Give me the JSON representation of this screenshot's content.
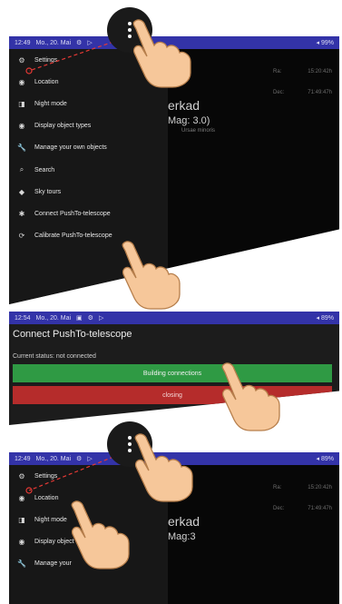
{
  "panel1": {
    "status_bar": {
      "time": "12:49",
      "date": "Mo., 20. Mai",
      "battery": "99%"
    },
    "menu_items": [
      {
        "label": "Settings",
        "icon": "gear-icon",
        "glyph": "⚙"
      },
      {
        "label": "Location",
        "icon": "location-icon",
        "glyph": "◉"
      },
      {
        "label": "Night mode",
        "icon": "night-mode-icon",
        "glyph": "◨"
      },
      {
        "label": "Display object types",
        "icon": "eye-icon",
        "glyph": "◉"
      },
      {
        "label": "Manage your own objects",
        "icon": "wrench-icon",
        "glyph": "🔧"
      },
      {
        "label": "Search",
        "icon": "search-icon",
        "glyph": "⌕"
      },
      {
        "label": "Sky tours",
        "icon": "tour-icon",
        "glyph": "◆"
      },
      {
        "label": "Connect PushTo-telescope",
        "icon": "bluetooth-icon",
        "glyph": "✱"
      },
      {
        "label": "Calibrate PushTo-telescope",
        "icon": "calibrate-icon",
        "glyph": "⟳"
      }
    ],
    "sky": {
      "ra_label": "Ra:",
      "ra_value": "15:20:42h",
      "dec_label": "Dec:",
      "dec_value": "71:49:47h",
      "object_name": "erkad",
      "object_mag": "Mag: 3.0)",
      "object_sub": "Ursae minoris"
    }
  },
  "panel2": {
    "status_bar": {
      "time": "12:54",
      "date": "Mo., 20. Mai",
      "battery": "89%"
    },
    "title": "Connect PushTo-telescope",
    "status_text": "Current status: not connected",
    "connect_button": "Building connections",
    "close_button": "closing"
  },
  "panel3": {
    "status_bar": {
      "time": "12:49",
      "date": "Mo., 20. Mai",
      "battery": "89%"
    },
    "menu_items": [
      {
        "label": "Settings",
        "icon": "gear-icon",
        "glyph": "⚙"
      },
      {
        "label": "Location",
        "icon": "location-icon",
        "glyph": "◉"
      },
      {
        "label": "Night mode",
        "icon": "night-mode-icon",
        "glyph": "◨"
      },
      {
        "label": "Display object types",
        "icon": "eye-icon",
        "glyph": "◉"
      },
      {
        "label": "Manage your",
        "icon": "wrench-icon",
        "glyph": "🔧"
      }
    ],
    "sky": {
      "ra_label": "Ra:",
      "ra_value": "15:20:42h",
      "dec_label": "Dec:",
      "dec_value": "71:49:47h",
      "object_name": "erkad",
      "object_mag": "Mag:3"
    }
  },
  "colors": {
    "status_bar": "#3333a8",
    "connect_button": "#2f9a44",
    "close_button": "#b52c2b",
    "tap_marker": "#e53935",
    "hand_skin": "#f6c79a"
  }
}
